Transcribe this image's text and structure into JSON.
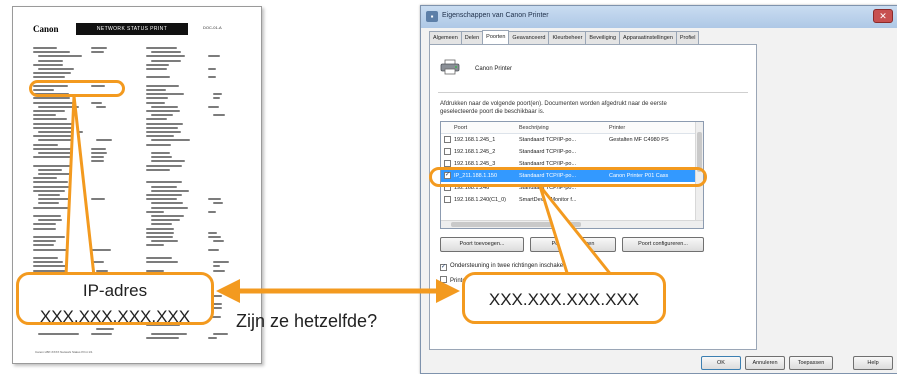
{
  "status_page": {
    "logo": "Canon",
    "banner": "NETWORK STATUS PRINT",
    "code": "DOC-01-A",
    "footer": "Canon LBP-XXXX  Network Status Print  1/1"
  },
  "callout_left": {
    "line1": "IP-adres",
    "line2": "XXX.XXX.XXX.XXX"
  },
  "callout_right": {
    "text": "XXX.XXX.XXX.XXX"
  },
  "arrow_label": "Zijn ze hetzelfde?",
  "dialog": {
    "title": "Eigenschappen van Canon Printer",
    "close": "✕",
    "tabs": [
      "Algemeen",
      "Delen",
      "Poorten",
      "Geavanceerd",
      "Kleurbeheer",
      "Beveiliging",
      "Apparaatinstellingen",
      "Profiel"
    ],
    "printer_name": "Canon Printer",
    "description": "Afdrukken naar de volgende poort(en). Documenten worden afgedrukt naar de eerste geselecteerde poort die beschikbaar is.",
    "columns": [
      "Poort",
      "Beschrijving",
      "Printer"
    ],
    "ports": [
      {
        "port": "192.168.1.245_1",
        "desc": "Standaard TCP/IP-po...",
        "printer": "Gestalten MF C4980 PS",
        "checked": false
      },
      {
        "port": "192.168.1.245_2",
        "desc": "Standaard TCP/IP-po...",
        "printer": "",
        "checked": false
      },
      {
        "port": "192.168.1.245_3",
        "desc": "Standaard TCP/IP-po...",
        "printer": "",
        "checked": false
      },
      {
        "port": "IP_211.188.1.150",
        "desc": "Standaard TCP/IP-po...",
        "printer": "Canon Printer P01 Cass",
        "checked": true
      },
      {
        "port": "192.168.1.246",
        "desc": "Standaard TCP/IP-po...",
        "printer": "",
        "checked": false
      },
      {
        "port": "192.168.1.240(C1_0)",
        "desc": "SmartDeviceMonitor f...",
        "printer": "",
        "checked": false
      }
    ],
    "btn_add": "Poort toevoegen...",
    "btn_delete": "Poort verwijderen",
    "btn_configure": "Poort configureren...",
    "bidirectional": "Ondersteuning in twee richtingen inschakelen",
    "pooling": "Printergroepering inschakelen",
    "ok": "OK",
    "cancel": "Annuleren",
    "apply": "Toepassen",
    "help": "Help"
  },
  "colors": {
    "highlight": "#f39a1f",
    "selection": "#3399ff"
  }
}
